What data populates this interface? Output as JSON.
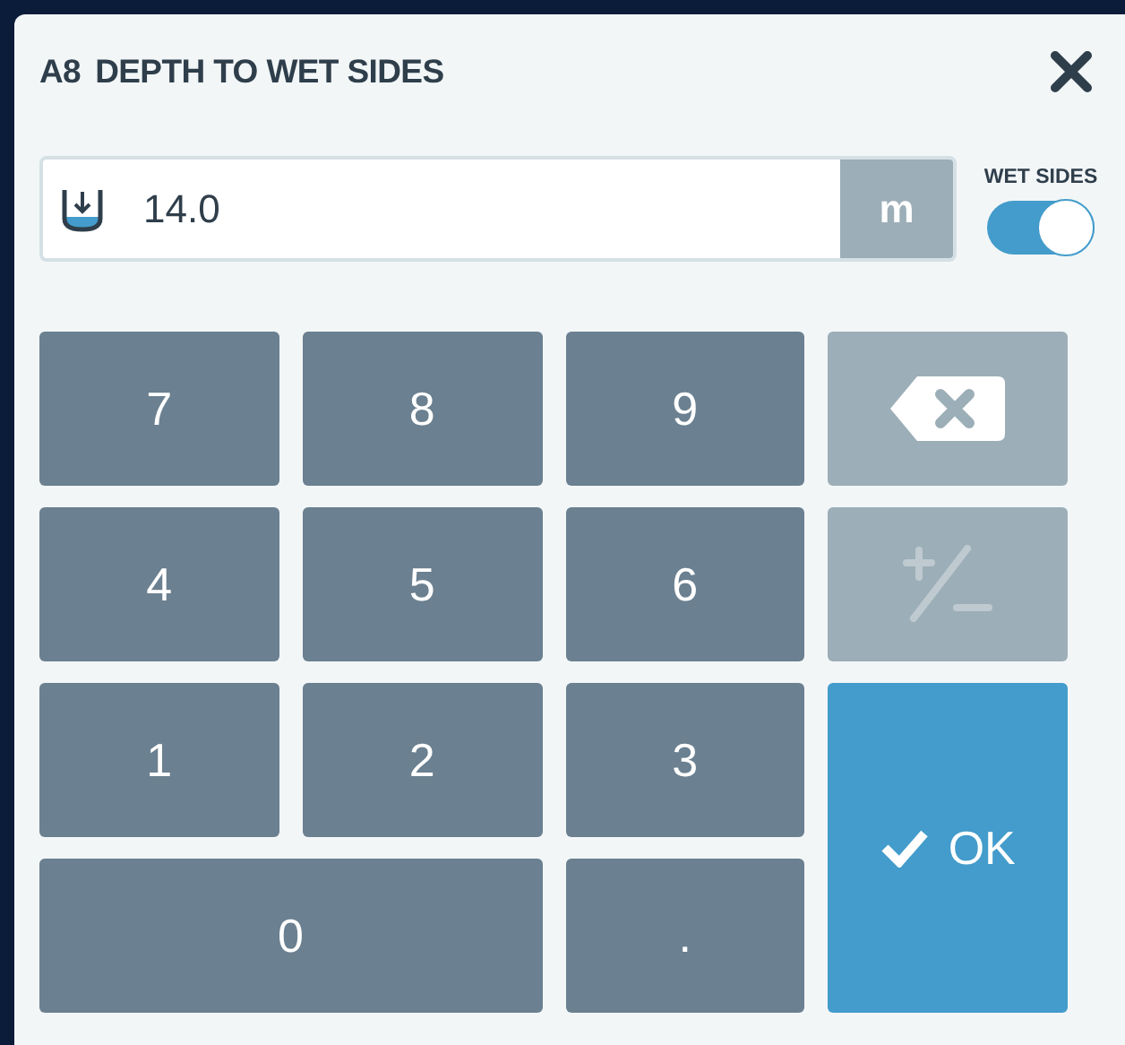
{
  "dialog": {
    "code": "A8",
    "title": "DEPTH TO WET SIDES"
  },
  "input": {
    "value": "14.0",
    "unit": "m"
  },
  "toggle": {
    "label": "WET SIDES",
    "on": true
  },
  "keys": [
    {
      "kind": "digit",
      "label": "7",
      "disabled": false
    },
    {
      "kind": "digit",
      "label": "8",
      "disabled": false
    },
    {
      "kind": "digit",
      "label": "9",
      "disabled": false
    },
    {
      "kind": "backspace",
      "disabled": false
    },
    {
      "kind": "digit",
      "label": "4",
      "disabled": false
    },
    {
      "kind": "digit",
      "label": "5",
      "disabled": false
    },
    {
      "kind": "digit",
      "label": "6",
      "disabled": false
    },
    {
      "kind": "sign",
      "disabled": true
    },
    {
      "kind": "digit",
      "label": "1",
      "disabled": false
    },
    {
      "kind": "digit",
      "label": "2",
      "disabled": false
    },
    {
      "kind": "digit",
      "label": "3",
      "disabled": false
    },
    {
      "kind": "confirm",
      "label": "OK",
      "disabled": false
    },
    {
      "kind": "wide",
      "label": "0",
      "disabled": false
    },
    {
      "kind": "digit",
      "label": ".",
      "disabled": false
    }
  ]
}
